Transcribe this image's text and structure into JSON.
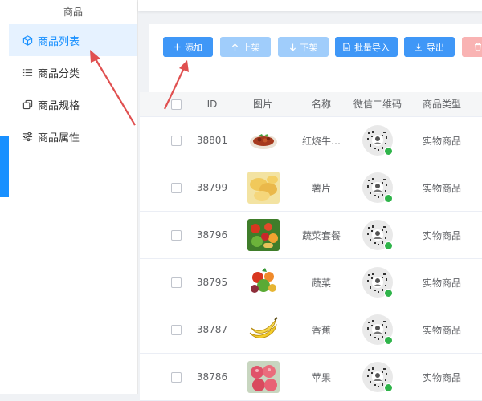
{
  "sidebar": {
    "group_title": "商品",
    "items": [
      {
        "label": "商品列表",
        "icon": "cube-icon",
        "active": true
      },
      {
        "label": "商品分类",
        "icon": "list-icon",
        "active": false
      },
      {
        "label": "商品规格",
        "icon": "copy-icon",
        "active": false
      },
      {
        "label": "商品属性",
        "icon": "sliders-icon",
        "active": false
      }
    ]
  },
  "toolbar": {
    "add_label": "添加",
    "on_shelf_label": "上架",
    "off_shelf_label": "下架",
    "batch_import_label": "批量导入",
    "export_label": "导出",
    "delete_icon": "trash-icon"
  },
  "table": {
    "headers": {
      "id": "ID",
      "image": "图片",
      "name": "名称",
      "wechat_qr": "微信二维码",
      "type": "商品类型"
    },
    "rows": [
      {
        "id": "38801",
        "name": "红烧牛…",
        "type": "实物商品",
        "image": "braised-beef-food-image"
      },
      {
        "id": "38799",
        "name": "薯片",
        "type": "实物商品",
        "image": "potato-chips-image"
      },
      {
        "id": "38796",
        "name": "蔬菜套餐",
        "type": "实物商品",
        "image": "vegetable-set-image"
      },
      {
        "id": "38795",
        "name": "蔬菜",
        "type": "实物商品",
        "image": "vegetables-image"
      },
      {
        "id": "38787",
        "name": "香蕉",
        "type": "实物商品",
        "image": "banana-image"
      },
      {
        "id": "38786",
        "name": "苹果",
        "type": "实物商品",
        "image": "apple-image"
      }
    ]
  },
  "colors": {
    "primary": "#3f97f7",
    "disabled": "#a0cdfb",
    "danger": "#f9b3b3",
    "annotation": "#e05050"
  }
}
